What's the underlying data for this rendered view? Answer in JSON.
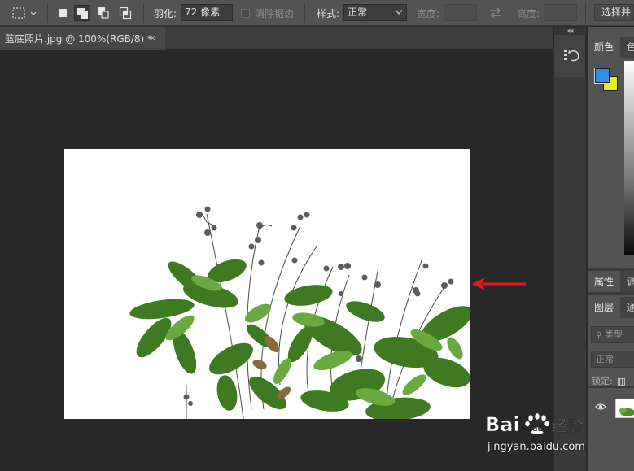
{
  "options_bar": {
    "feather_label": "羽化:",
    "feather_value": "72 像素",
    "antialias_label": "消除锯齿",
    "style_label": "样式:",
    "style_value": "正常",
    "width_label": "宽度:",
    "height_label": "高度:",
    "select_mask_button": "选择并"
  },
  "document": {
    "tab_title": "蓝底照片.jpg @ 100%(RGB/8) *",
    "close_symbol": "×"
  },
  "panels": {
    "color_tab": "颜色",
    "color_tab2": "色",
    "properties_tab": "属性",
    "properties_tab2": "调",
    "layers_tab": "图层",
    "layers_tab2": "通",
    "layer_filter_placeholder": "类型",
    "blend_mode": "正常",
    "lock_label": "锁定:"
  },
  "colors": {
    "foreground": "#2f8fe2",
    "background": "#eaea2c",
    "annotation_arrow": "#e21b1b"
  },
  "watermark": {
    "url": "jingyan.baidu.com"
  }
}
